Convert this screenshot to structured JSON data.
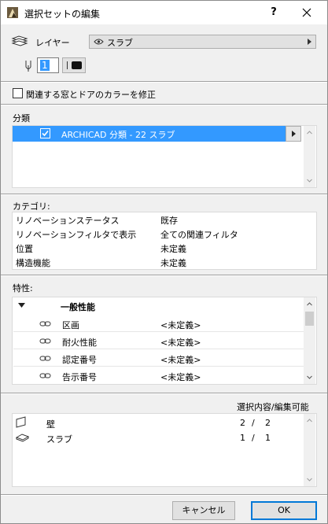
{
  "title": "選択セットの編集",
  "title_buttons": {
    "help": "?"
  },
  "layer": {
    "label": "レイヤー",
    "value": "スラブ"
  },
  "pen": {
    "value": "1"
  },
  "checkbox": {
    "label": "関連する窓とドアのカラーを修正",
    "checked": false
  },
  "classification": {
    "heading": "分類",
    "items": [
      {
        "label": "ARCHICAD 分類 - 22 スラブ",
        "checked": true
      }
    ]
  },
  "category": {
    "heading": "カテゴリ:",
    "rows": [
      {
        "name": "リノベーションステータス",
        "value": "既存"
      },
      {
        "name": "リノベーションフィルタで表示",
        "value": "全ての関連フィルタ"
      },
      {
        "name": "位置",
        "value": "未定義"
      },
      {
        "name": "構造機能",
        "value": "未定義"
      }
    ]
  },
  "properties": {
    "heading": "特性:",
    "group": "一般性能",
    "rows": [
      {
        "name": "区画",
        "value": "<未定義>"
      },
      {
        "name": "耐火性能",
        "value": "<未定義>"
      },
      {
        "name": "認定番号",
        "value": "<未定義>"
      },
      {
        "name": "告示番号",
        "value": "<未定義>"
      }
    ]
  },
  "selection": {
    "heading": "選択内容/編集可能",
    "rows": [
      {
        "icon": "wall-icon",
        "name": "壁",
        "editable": "2",
        "sep": "/",
        "total": "2"
      },
      {
        "icon": "slab-icon",
        "name": "スラブ",
        "editable": "1",
        "sep": "/",
        "total": "1"
      }
    ]
  },
  "buttons": {
    "cancel": "キャンセル",
    "ok": "OK"
  },
  "colors": {
    "accent": "#3399ff",
    "default_button_border": "#0078d7"
  }
}
